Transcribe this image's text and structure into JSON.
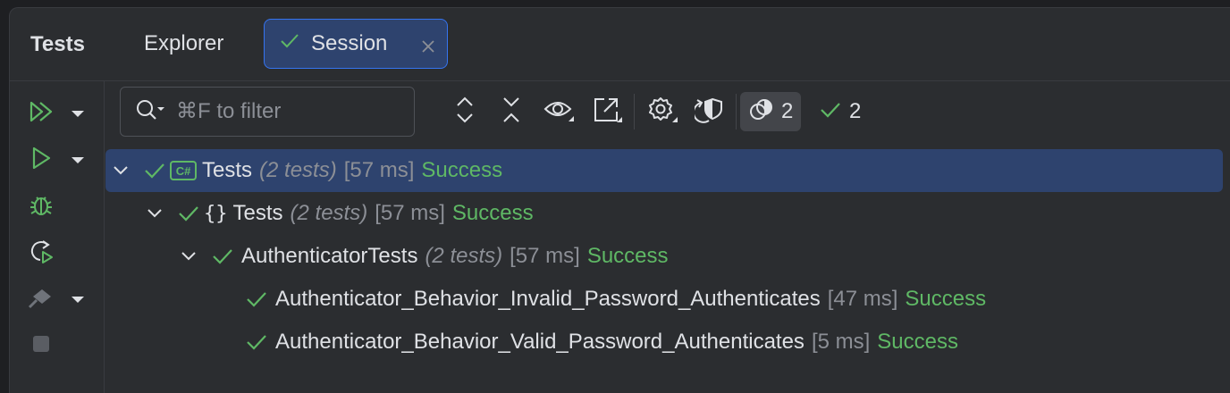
{
  "panel": {
    "title": "Tests"
  },
  "tabs": [
    {
      "label": "Explorer",
      "active": false
    },
    {
      "label": "Session",
      "active": true,
      "status_icon": "check-icon",
      "closable": true
    }
  ],
  "gutter": {
    "buttons": [
      "run-all-icon",
      "run-icon",
      "debug-icon",
      "rerun-icon",
      "coverage-icon",
      "stop-icon"
    ]
  },
  "toolbar": {
    "search_placeholder": "⌘F to filter",
    "icons": [
      "expand-all-icon",
      "collapse-all-icon",
      "show-icon",
      "export-icon",
      "settings-icon",
      "rerun-failed-icon"
    ],
    "filter_badge_count": "2",
    "passed_count": "2"
  },
  "tree": [
    {
      "level": 0,
      "name": "Tests",
      "kind": "csharp-project",
      "count": "(2 tests)",
      "duration": "[57 ms]",
      "status": "Success",
      "selected": true
    },
    {
      "level": 1,
      "name": "Tests",
      "kind": "namespace",
      "count": "(2 tests)",
      "duration": "[57 ms]",
      "status": "Success"
    },
    {
      "level": 2,
      "name": "AuthenticatorTests",
      "kind": "class",
      "count": "(2 tests)",
      "duration": "[57 ms]",
      "status": "Success"
    },
    {
      "level": 3,
      "name": "Authenticator_Behavior_Invalid_Password_Authenticates",
      "kind": "test",
      "duration": "[47 ms]",
      "status": "Success"
    },
    {
      "level": 3,
      "name": "Authenticator_Behavior_Valid_Password_Authenticates",
      "kind": "test",
      "duration": "[5 ms]",
      "status": "Success"
    }
  ],
  "colors": {
    "accent": "#3574f0",
    "selection": "#2e436e",
    "success": "#5fb865",
    "run": "#5fb865",
    "muted": "#8c8f96"
  }
}
